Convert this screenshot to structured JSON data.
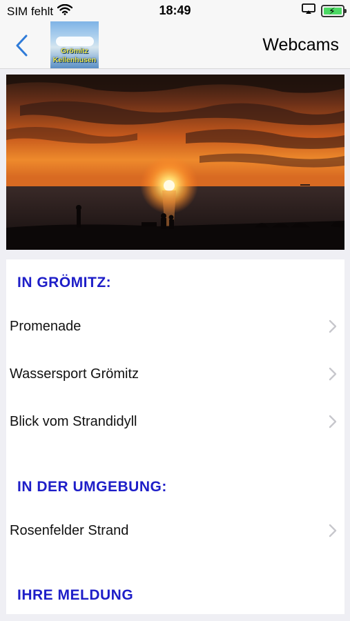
{
  "status_bar": {
    "carrier": "SIM fehlt",
    "time": "18:49"
  },
  "nav": {
    "title": "Webcams",
    "logo_line1": "Grömitz",
    "logo_line2": "Kellenhusen"
  },
  "colors": {
    "accent_blue": "#1e1ec8",
    "back_chevron": "#2f7bd8",
    "battery_green": "#4cd964"
  },
  "list": {
    "section1_title": "IN GRÖMITZ:",
    "section1_items": [
      "Promenade",
      "Wassersport Grömitz",
      "Blick vom Strandidyll"
    ],
    "section2_title": "IN DER UMGEBUNG:",
    "section2_items": [
      "Rosenfelder Strand"
    ],
    "section3_title": "IHRE MELDUNG"
  }
}
